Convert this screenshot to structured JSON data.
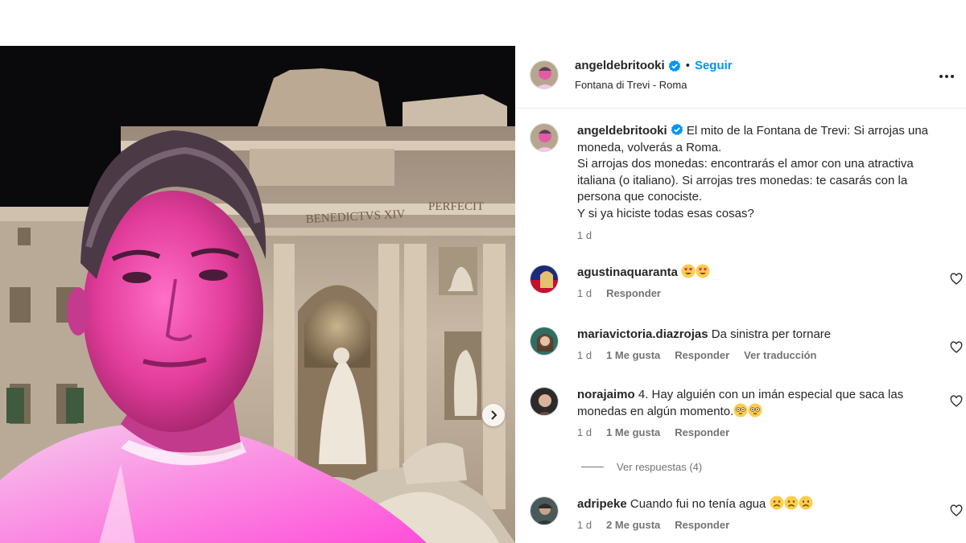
{
  "post": {
    "username": "angeldebritooki",
    "follow_label": "Seguir",
    "separator": "•",
    "location": "Fontana di Trevi - Roma",
    "caption_lines": [
      "El mito de la Fontana de Trevi: Si arrojas una",
      "moneda, volverás a Roma.",
      "Si arrojas dos monedas: encontrarás el amor con una atractiva",
      "italiana (o italiano). Si arrojas tres monedas: te casarás con la",
      "persona que conociste.",
      "Y si ya hiciste todas esas cosas?"
    ],
    "caption_time": "1 d",
    "photo_inscriptions": [
      "PERFECIT",
      "BENEDICTVS XIV"
    ]
  },
  "comments": [
    {
      "username": "agustinaquaranta",
      "text": "",
      "emojis": [
        "heart-eyes",
        "heart-eyes"
      ],
      "time": "1 d",
      "likes": "",
      "reply_label": "Responder",
      "translate_label": ""
    },
    {
      "username": "mariavictoria.diazrojas",
      "text": "Da sinistra per tornare",
      "emojis": [],
      "time": "1 d",
      "likes": "1 Me gusta",
      "reply_label": "Responder",
      "translate_label": "Ver traducción"
    },
    {
      "username": "norajaimo",
      "text_line1": "4. Hay alguién con un imán especial que saca las",
      "text_line2": "monedas en algún momento.",
      "emojis": [
        "flushed",
        "flushed"
      ],
      "time": "1 d",
      "likes": "1 Me gusta",
      "reply_label": "Responder",
      "translate_label": ""
    },
    {
      "username": "adripeke",
      "text": "Cuando fui no tenía agua",
      "emojis": [
        "sad",
        "sad",
        "sad"
      ],
      "time": "1 d",
      "likes": "2 Me gusta",
      "reply_label": "Responder",
      "translate_label": ""
    }
  ],
  "view_replies_label": "Ver respuestas (4)",
  "icons": {
    "verified": "verified-badge-icon",
    "more": "more-horizontal-icon",
    "like": "heart-outline-icon",
    "next": "chevron-right-icon"
  },
  "colors": {
    "accent": "#0095f6",
    "text": "#262626",
    "secondary": "#737373",
    "divider": "#efefef"
  }
}
